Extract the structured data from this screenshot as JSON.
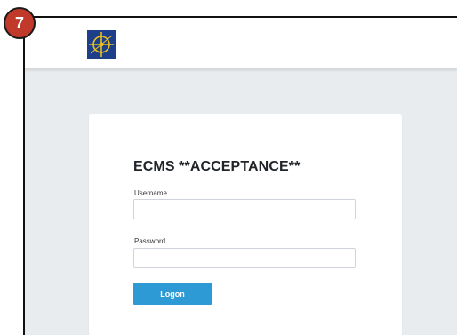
{
  "step_badge": {
    "number": "7",
    "color": "#c0392b"
  },
  "header": {
    "logo_icon": "compass-rose-logo-icon"
  },
  "login": {
    "title": "ECMS **ACCEPTANCE**",
    "username_label": "Username",
    "username_value": "",
    "password_label": "Password",
    "password_value": "",
    "logon_label": "Logon"
  },
  "colors": {
    "accent": "#2d9ad6",
    "background": "#e9ecef",
    "logo_bg": "#1d3f8a",
    "logo_fg": "#e8c020"
  }
}
